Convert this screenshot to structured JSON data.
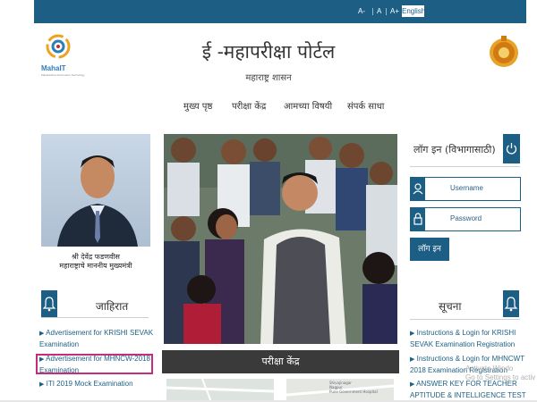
{
  "topbar": {
    "font_small": "A-",
    "font_normal": "A",
    "font_large": "A+",
    "separator": "|",
    "language_button": "English",
    "color": "#1d5f84"
  },
  "header": {
    "logo_text": "MahaIT",
    "logo_subtext": "Maharashtra Information Technology",
    "title": "ई -महापरीक्षा पोर्टल",
    "subtitle": "महाराष्ट्र शासन"
  },
  "nav": {
    "items": [
      "मुख्य पृष्ठ",
      "परीक्षा केंद्र",
      "आमच्या विषयी",
      "संपर्क साधा"
    ]
  },
  "left": {
    "cm_caption_line1": "श्री देवेंद्र फडणवीस",
    "cm_caption_line2": "महाराष्ट्राचे माननीय मुख्यमंत्री",
    "ads_title": "जाहिरात",
    "ads": [
      {
        "line1": "Advertisement for KRISHI SEVAK",
        "line2": "Examination"
      },
      {
        "line1": "Advertisement for MHNCW-2018",
        "line2": "Examination"
      },
      {
        "line1": "ITI 2019 Mock Examination",
        "line2": ""
      }
    ]
  },
  "center": {
    "banner": "परीक्षा केंद्र",
    "map_text": [
      "Shivajinagar",
      "Nagpur",
      "Pune Government Hospital"
    ]
  },
  "login": {
    "title": "लॉग इन (विभागासाठी)",
    "username_placeholder": "Username",
    "password_placeholder": "Password",
    "button": "लॉग इन"
  },
  "notices": {
    "title": "सूचना",
    "items": [
      {
        "line1": "Instructions & Login for KRISHI",
        "line2": "SEVAK Examination Registration"
      },
      {
        "line1": "Instructions & Login for MHNCWT",
        "line2": "2018 Examination Registration"
      },
      {
        "line1": "ANSWER KEY FOR TEACHER",
        "line2": "APTITUDE & INTELLIGENCE TEST"
      }
    ]
  },
  "watermark": {
    "line1": "Activate Windo",
    "line2": "Go to Settings to activ"
  }
}
